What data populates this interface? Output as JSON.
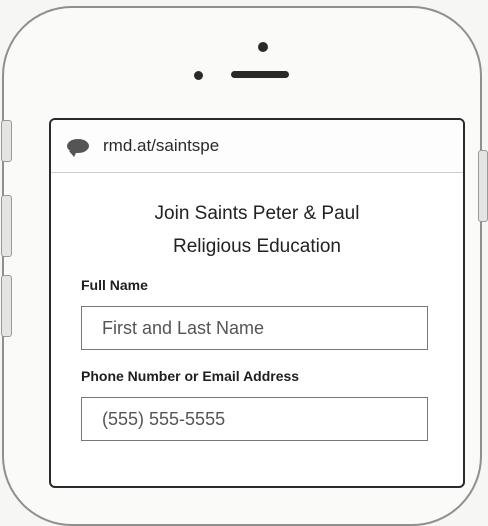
{
  "browser": {
    "url": "rmd.at/saintspe"
  },
  "form": {
    "title_line1": "Join Saints Peter & Paul",
    "title_line2": "Religious Education",
    "full_name_label": "Full Name",
    "full_name_placeholder": "First and Last Name",
    "contact_label": "Phone Number or Email Address",
    "contact_placeholder": "(555) 555-5555"
  },
  "icons": {
    "url_icon": "chat-bubble-icon"
  }
}
